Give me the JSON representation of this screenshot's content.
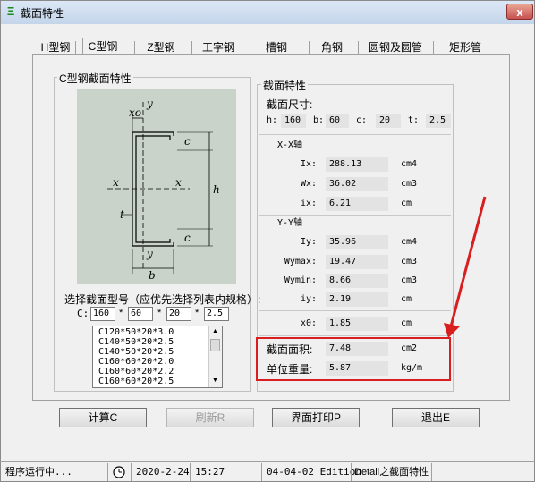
{
  "window": {
    "title": "截面特性",
    "app_icon": "app-icon",
    "close_label": "x"
  },
  "tabs": [
    {
      "label": "H型钢"
    },
    {
      "label": "C型钢",
      "selected": true
    },
    {
      "label": "Z型钢"
    },
    {
      "label": "工字钢"
    },
    {
      "label": "槽钢"
    },
    {
      "label": "角钢"
    },
    {
      "label": "圆钢及圆管"
    },
    {
      "label": "矩形管"
    }
  ],
  "left_group": {
    "title": "C型钢截面特性",
    "diagram_labels": {
      "y_top": "y",
      "x_left": "x",
      "x_right": "x",
      "y_bottom": "y",
      "xo": "xo",
      "c_top": "c",
      "c_bottom": "c",
      "h": "h",
      "t": "t",
      "b": "b"
    },
    "select_caption": "选择截面型号（应优先选择列表内规格）:",
    "c_label": "C:",
    "inputs": {
      "h": "160",
      "b": "60",
      "c": "20",
      "t": "2.5"
    },
    "separators": {
      "s1": "*",
      "s2": "*",
      "s3": "*"
    },
    "list": [
      "C120*50*20*3.0",
      "C140*50*20*2.5",
      "C140*50*20*2.5",
      "C160*60*20*2.0",
      "C160*60*20*2.2",
      "C160*60*20*2.5"
    ]
  },
  "right_group": {
    "title": "截面特性",
    "dims_title": "截面尺寸:",
    "dims": {
      "h_label": "h:",
      "h": "160",
      "b_label": "b:",
      "b": "60",
      "c_label": "c:",
      "c": "20",
      "t_label": "t:",
      "t": "2.5"
    },
    "xx_title": "X-X轴",
    "xx": [
      {
        "label": "Ix:",
        "value": "288.13",
        "unit": "cm4"
      },
      {
        "label": "Wx:",
        "value": "36.02",
        "unit": "cm3"
      },
      {
        "label": "ix:",
        "value": "6.21",
        "unit": "cm"
      }
    ],
    "yy_title": "Y-Y轴",
    "yy": [
      {
        "label": "Iy:",
        "value": "35.96",
        "unit": "cm4"
      },
      {
        "label": "Wymax:",
        "value": "19.47",
        "unit": "cm3"
      },
      {
        "label": "Wymin:",
        "value": "8.66",
        "unit": "cm3"
      },
      {
        "label": "iy:",
        "value": "2.19",
        "unit": "cm"
      }
    ],
    "x0": {
      "label": "x0:",
      "value": "1.85",
      "unit": "cm"
    },
    "area": {
      "label": "截面面积:",
      "value": "7.48",
      "unit": "cm2"
    },
    "weight": {
      "label": "单位重量:",
      "value": "5.87",
      "unit": "kg/m"
    }
  },
  "buttons": {
    "calc": "计算C",
    "refresh": "刷新R",
    "print": "界面打印P",
    "exit": "退出E"
  },
  "statusbar": {
    "running": "程序运行中...",
    "date": "2020-2-24",
    "time": "15:27",
    "edition": "04-04-02 Edition",
    "detail": "Detail之截面特性"
  },
  "colors": {
    "highlight": "#d81e1e",
    "diagram_bg": "#c9d3c9"
  }
}
